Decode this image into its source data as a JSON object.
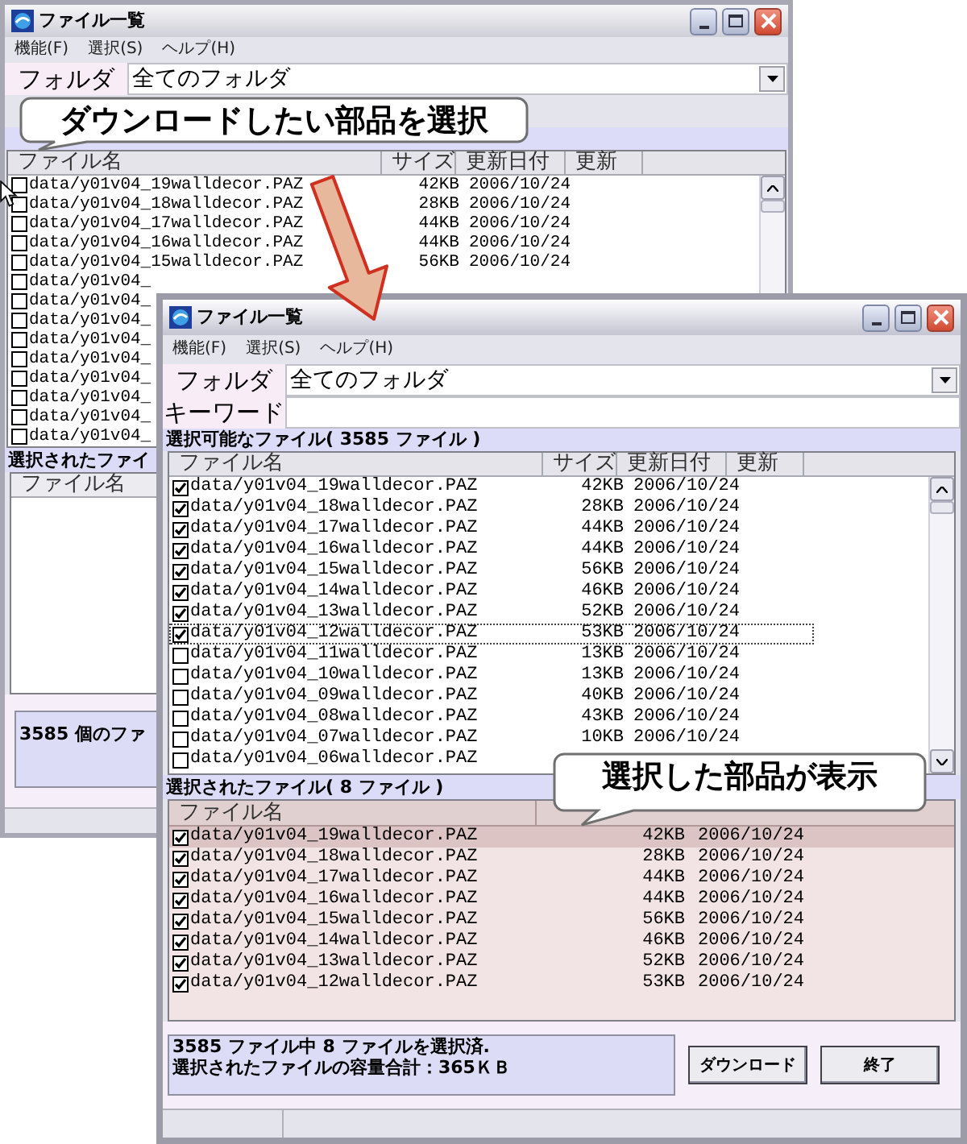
{
  "back_window": {
    "title": "ファイル一覧",
    "menu": [
      "機能(F)",
      "選択(S)",
      "ヘルプ(H)"
    ],
    "folder_label": "フォルダ",
    "folder_value": "全てのフォルダ",
    "file_table": {
      "columns": [
        "ファイル名",
        "サイズ",
        "更新日付",
        "更新"
      ],
      "rows": [
        {
          "name": "data/y01v04_19walldecor.PAZ",
          "size": "42KB",
          "date": "2006/10/24",
          "checked": false
        },
        {
          "name": "data/y01v04_18walldecor.PAZ",
          "size": "28KB",
          "date": "2006/10/24",
          "checked": false
        },
        {
          "name": "data/y01v04_17walldecor.PAZ",
          "size": "44KB",
          "date": "2006/10/24",
          "checked": false
        },
        {
          "name": "data/y01v04_16walldecor.PAZ",
          "size": "44KB",
          "date": "2006/10/24",
          "checked": false
        },
        {
          "name": "data/y01v04_15walldecor.PAZ",
          "size": "56KB",
          "date": "2006/10/24",
          "checked": false
        },
        {
          "name": "data/y01v04_",
          "checked": false
        },
        {
          "name": "data/y01v04_",
          "checked": false
        },
        {
          "name": "data/y01v04_",
          "checked": false
        },
        {
          "name": "data/y01v04_",
          "checked": false
        },
        {
          "name": "data/y01v04_",
          "checked": false
        },
        {
          "name": "data/y01v04_",
          "checked": false
        },
        {
          "name": "data/y01v04_",
          "checked": false
        },
        {
          "name": "data/y01v04_",
          "checked": false
        },
        {
          "name": "data/y01v04_",
          "checked": false
        }
      ]
    },
    "selected_label": "選択されたファイ",
    "selected_table": {
      "columns": [
        "ファイル名"
      ]
    },
    "status": "3585 個のファ"
  },
  "front_window": {
    "title": "ファイル一覧",
    "menu": [
      "機能(F)",
      "選択(S)",
      "ヘルプ(H)"
    ],
    "folder_label": "フォルダ",
    "folder_value": "全てのフォルダ",
    "keyword_label": "キーワード",
    "available_label": "選択可能なファイル( 3585 ファイル )",
    "file_table": {
      "columns": [
        "ファイル名",
        "サイズ",
        "更新日付",
        "更新"
      ],
      "rows": [
        {
          "name": "data/y01v04_19walldecor.PAZ",
          "size": "42KB",
          "date": "2006/10/24",
          "checked": true,
          "focused": false
        },
        {
          "name": "data/y01v04_18walldecor.PAZ",
          "size": "28KB",
          "date": "2006/10/24",
          "checked": true,
          "focused": false
        },
        {
          "name": "data/y01v04_17walldecor.PAZ",
          "size": "44KB",
          "date": "2006/10/24",
          "checked": true,
          "focused": false
        },
        {
          "name": "data/y01v04_16walldecor.PAZ",
          "size": "44KB",
          "date": "2006/10/24",
          "checked": true,
          "focused": false
        },
        {
          "name": "data/y01v04_15walldecor.PAZ",
          "size": "56KB",
          "date": "2006/10/24",
          "checked": true,
          "focused": false
        },
        {
          "name": "data/y01v04_14walldecor.PAZ",
          "size": "46KB",
          "date": "2006/10/24",
          "checked": true,
          "focused": false
        },
        {
          "name": "data/y01v04_13walldecor.PAZ",
          "size": "52KB",
          "date": "2006/10/24",
          "checked": true,
          "focused": false
        },
        {
          "name": "data/y01v04_12walldecor.PAZ",
          "size": "53KB",
          "date": "2006/10/24",
          "checked": true,
          "focused": true
        },
        {
          "name": "data/y01v04_11walldecor.PAZ",
          "size": "13KB",
          "date": "2006/10/24",
          "checked": false,
          "focused": false
        },
        {
          "name": "data/y01v04_10walldecor.PAZ",
          "size": "13KB",
          "date": "2006/10/24",
          "checked": false,
          "focused": false
        },
        {
          "name": "data/y01v04_09walldecor.PAZ",
          "size": "40KB",
          "date": "2006/10/24",
          "checked": false,
          "focused": false
        },
        {
          "name": "data/y01v04_08walldecor.PAZ",
          "size": "43KB",
          "date": "2006/10/24",
          "checked": false,
          "focused": false
        },
        {
          "name": "data/y01v04_07walldecor.PAZ",
          "size": "10KB",
          "date": "2006/10/24",
          "checked": false,
          "focused": false
        },
        {
          "name": "data/y01v04_06walldecor.PAZ",
          "checked": false,
          "focused": false
        }
      ]
    },
    "selected_label": "選択されたファイル( 8 ファイル )",
    "selected_table": {
      "columns": [
        "ファイル名"
      ],
      "rows": [
        {
          "name": "data/y01v04_19walldecor.PAZ",
          "size": "42KB",
          "date": "2006/10/24",
          "checked": true,
          "selected": true
        },
        {
          "name": "data/y01v04_18walldecor.PAZ",
          "size": "28KB",
          "date": "2006/10/24",
          "checked": true,
          "selected": false
        },
        {
          "name": "data/y01v04_17walldecor.PAZ",
          "size": "44KB",
          "date": "2006/10/24",
          "checked": true,
          "selected": false
        },
        {
          "name": "data/y01v04_16walldecor.PAZ",
          "size": "44KB",
          "date": "2006/10/24",
          "checked": true,
          "selected": false
        },
        {
          "name": "data/y01v04_15walldecor.PAZ",
          "size": "56KB",
          "date": "2006/10/24",
          "checked": true,
          "selected": false
        },
        {
          "name": "data/y01v04_14walldecor.PAZ",
          "size": "46KB",
          "date": "2006/10/24",
          "checked": true,
          "selected": false
        },
        {
          "name": "data/y01v04_13walldecor.PAZ",
          "size": "52KB",
          "date": "2006/10/24",
          "checked": true,
          "selected": false
        },
        {
          "name": "data/y01v04_12walldecor.PAZ",
          "size": "53KB",
          "date": "2006/10/24",
          "checked": true,
          "selected": false
        }
      ]
    },
    "status": [
      "3585 ファイル中 8 ファイルを選択済.",
      "選択されたファイルの容量合計：365ＫＢ"
    ],
    "buttons": [
      "ダウンロード",
      "終了"
    ]
  },
  "callouts": [
    "ダウンロードしたい部品を選択",
    "選択した部品が表示"
  ]
}
